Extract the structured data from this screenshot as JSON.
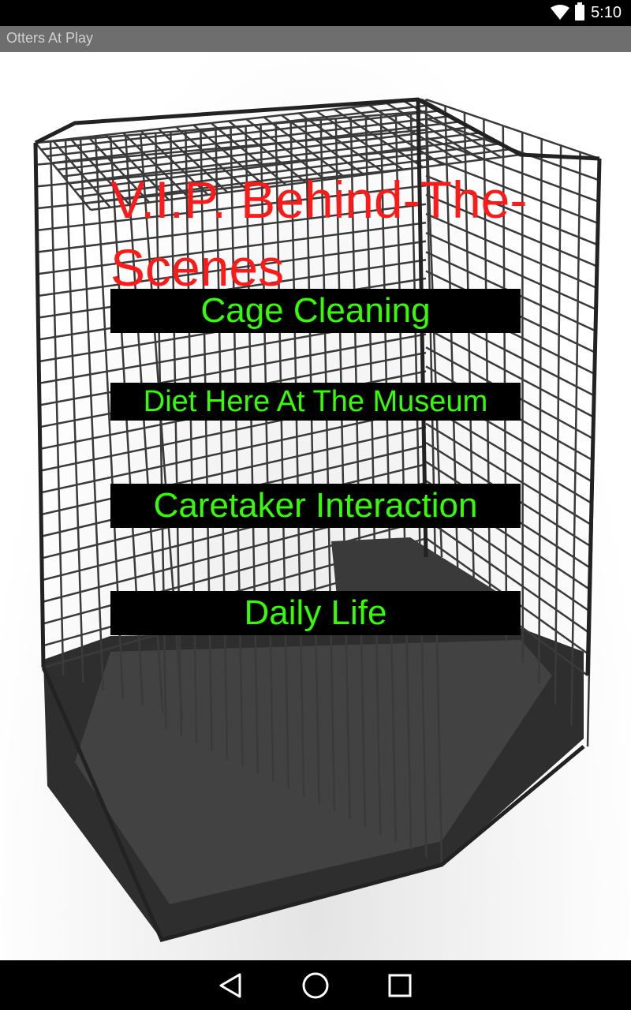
{
  "status_bar": {
    "time": "5:10",
    "icons": [
      "wifi-icon",
      "battery-icon"
    ]
  },
  "app": {
    "title": "Otters At Play"
  },
  "screen": {
    "heading": "V.I.P. Behind-The-Scenes",
    "background_image": "wire-dog-cage",
    "heading_color": "#ff1a1a",
    "button_text_color": "#33ff00",
    "button_bg_color": "#000000",
    "buttons": [
      {
        "label": "Cage Cleaning"
      },
      {
        "label": "Diet Here At The Museum"
      },
      {
        "label": "Caretaker Interaction"
      },
      {
        "label": "Daily Life"
      }
    ]
  },
  "nav_bar": {
    "icons": [
      "back-icon",
      "home-icon",
      "recents-icon"
    ]
  }
}
